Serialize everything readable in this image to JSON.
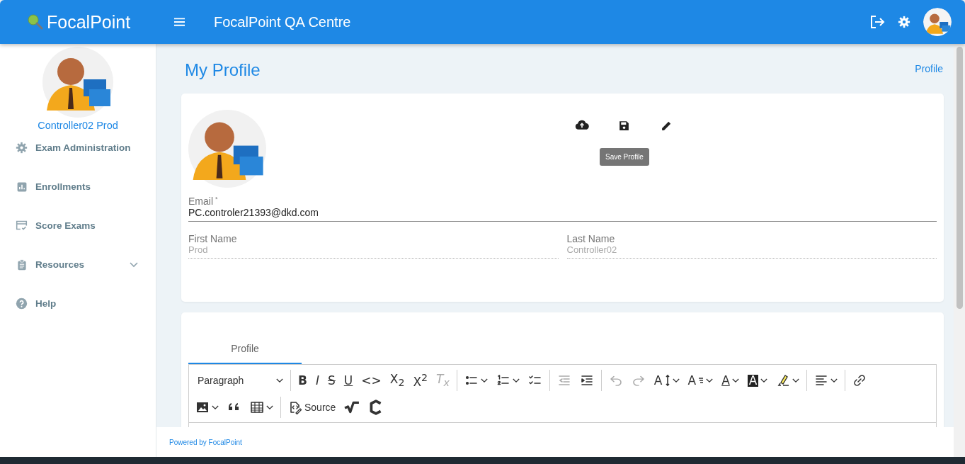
{
  "header": {
    "brand": "FocalPoint",
    "title": "FocalPoint QA Centre"
  },
  "sidebar": {
    "user_name": "Controller02 Prod",
    "items": [
      {
        "label": "Exam Administration",
        "has_submenu": false
      },
      {
        "label": "Enrollments",
        "has_submenu": false
      },
      {
        "label": "Score Exams",
        "has_submenu": false
      },
      {
        "label": "Resources",
        "has_submenu": true
      },
      {
        "label": "Help",
        "has_submenu": false
      }
    ]
  },
  "page": {
    "title": "My Profile",
    "breadcrumb": "Profile"
  },
  "profile_card": {
    "tooltip": "Save Profile",
    "fields": [
      {
        "label": "Email",
        "required_mark": "*",
        "value": "PC.controler21393@dkd.com",
        "disabled": false
      },
      {
        "label": "First Name",
        "value": "Prod",
        "disabled": true
      },
      {
        "label": "Last Name",
        "value": "Controller02",
        "disabled": true
      }
    ]
  },
  "editor_card": {
    "tabs": [
      {
        "label": "Profile",
        "selected": true
      }
    ],
    "toolbar_rows": [
      [
        {
          "kind": "select",
          "label": "Paragraph",
          "dropdown": true,
          "disabled": false
        },
        {
          "kind": "separator"
        },
        {
          "kind": "button",
          "glyph": "B",
          "dropdown": false,
          "disabled": false
        },
        {
          "kind": "button",
          "glyph": "I",
          "dropdown": false,
          "disabled": false
        },
        {
          "kind": "button",
          "glyph": "S",
          "dropdown": false,
          "disabled": false
        },
        {
          "kind": "button",
          "glyph": "U",
          "dropdown": false,
          "disabled": false
        },
        {
          "kind": "button",
          "glyph": "<>",
          "dropdown": false,
          "disabled": false
        },
        {
          "kind": "button",
          "glyph": "X$_{2}$",
          "dropdown": false,
          "disabled": false
        },
        {
          "kind": "button",
          "glyph": "X$^{2}$",
          "dropdown": false,
          "disabled": false
        },
        {
          "kind": "button",
          "glyph": "T$_{x}$",
          "dropdown": false,
          "disabled": true
        },
        {
          "kind": "separator"
        },
        {
          "kind": "button",
          "dropdown": true,
          "disabled": false
        },
        {
          "kind": "button",
          "dropdown": true,
          "disabled": false
        },
        {
          "kind": "button",
          "dropdown": false,
          "disabled": false
        },
        {
          "kind": "separator"
        },
        {
          "kind": "button",
          "dropdown": false,
          "disabled": true
        },
        {
          "kind": "button",
          "dropdown": false,
          "disabled": false
        },
        {
          "kind": "separator"
        },
        {
          "kind": "button",
          "dropdown": false,
          "disabled": true
        },
        {
          "kind": "button",
          "dropdown": false,
          "disabled": true
        },
        {
          "kind": "button",
          "glyph": "A",
          "dropdown": true,
          "disabled": false
        },
        {
          "kind": "button",
          "glyph": "A",
          "dropdown": true,
          "disabled": false
        },
        {
          "kind": "button",
          "glyph": "A",
          "dropdown": true,
          "disabled": false
        },
        {
          "kind": "button",
          "glyph": "A",
          "dropdown": true,
          "disabled": false
        },
        {
          "kind": "button",
          "dropdown": true,
          "disabled": false
        },
        {
          "kind": "separator"
        },
        {
          "kind": "button",
          "dropdown": true,
          "disabled": false
        },
        {
          "kind": "separator"
        },
        {
          "kind": "button",
          "dropdown": false,
          "disabled": false
        }
      ],
      [
        {
          "kind": "button",
          "dropdown": true,
          "disabled": false
        },
        {
          "kind": "button",
          "dropdown": false,
          "disabled": false
        },
        {
          "kind": "button",
          "dropdown": true,
          "disabled": false
        },
        {
          "kind": "separator"
        },
        {
          "kind": "button",
          "label": "Source",
          "dropdown": false,
          "disabled": false
        },
        {
          "kind": "button",
          "dropdown": false,
          "disabled": false
        },
        {
          "kind": "button",
          "dropdown": false,
          "disabled": false
        }
      ]
    ]
  },
  "footer": {
    "text": "Powered by FocalPoint"
  }
}
